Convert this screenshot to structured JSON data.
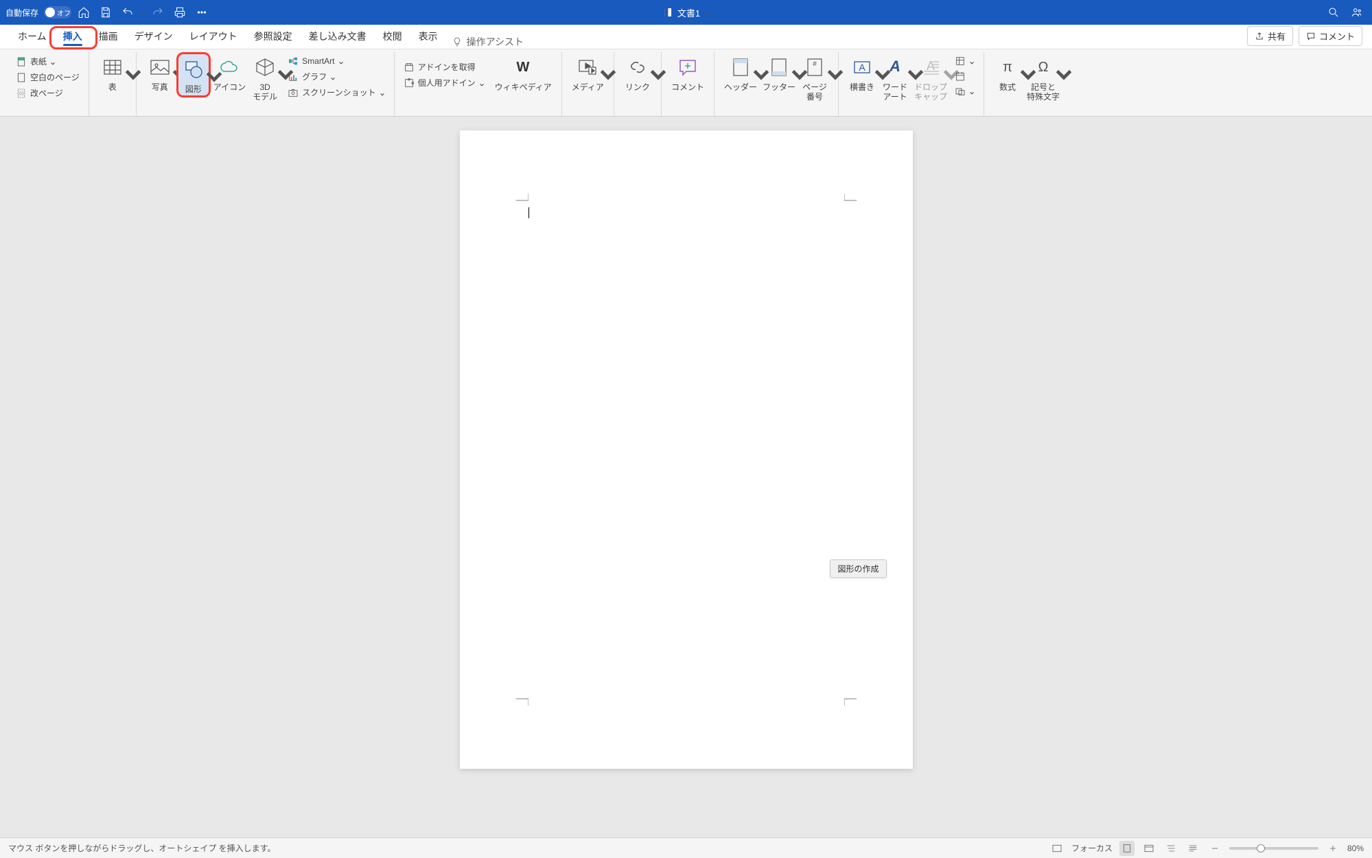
{
  "titlebar": {
    "autosave_label": "自動保存",
    "autosave_state": "オフ",
    "doc_title": "文書1"
  },
  "tabs": {
    "items": [
      "ホーム",
      "挿入",
      "描画",
      "デザイン",
      "レイアウト",
      "参照設定",
      "差し込み文書",
      "校閲",
      "表示"
    ],
    "assist": "操作アシスト",
    "share": "共有",
    "comment": "コメント"
  },
  "ribbon": {
    "pages": {
      "cover": "表紙",
      "blank": "空白のページ",
      "break": "改ページ"
    },
    "table": "表",
    "picture": "写真",
    "shapes": "図形",
    "icons": "アイコン",
    "model3d": "3D\nモデル",
    "smartart": "SmartArt",
    "chart": "グラフ",
    "screenshot": "スクリーンショット",
    "get_addins": "アドインを取得",
    "my_addins": "個人用アドイン",
    "wikipedia": "ウィキペディア",
    "media": "メディア",
    "link": "リンク",
    "comment": "コメント",
    "header": "ヘッダー",
    "footer": "フッター",
    "page_number": "ページ\n番号",
    "textbox": "横書き",
    "wordart": "ワード\nアート",
    "dropcap": "ドロップ\nキャップ",
    "equation": "数式",
    "symbol": "記号と\n特殊文字"
  },
  "tooltip": "図形の作成",
  "statusbar": {
    "message": "マウス ボタンを押しながらドラッグし、オートシェイプ を挿入します。",
    "focus": "フォーカス",
    "zoom": "80%"
  }
}
